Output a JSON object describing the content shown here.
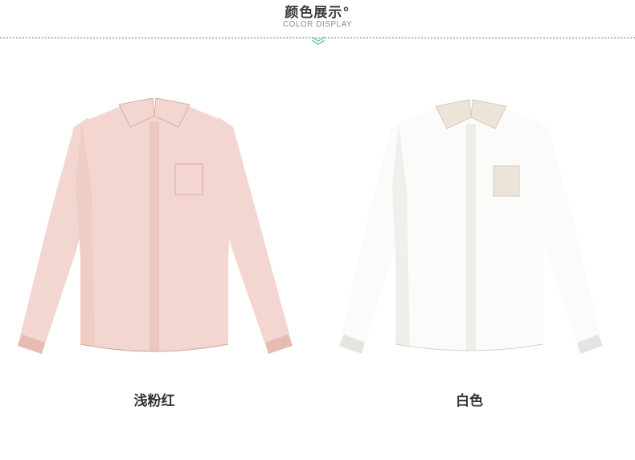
{
  "header": {
    "title": "颜色展示°",
    "subtitle": "COLOR DISPLAY"
  },
  "products": [
    {
      "color_name": "浅粉红",
      "fill": "#f3d6cf",
      "shade": "#e6bcb2",
      "trim": "#f3d6cf"
    },
    {
      "color_name": "白色",
      "fill": "#fbfbf9",
      "shade": "#e4e4e0",
      "trim": "#ece3d9"
    }
  ],
  "colors": {
    "accent": "#7cc4b8"
  }
}
